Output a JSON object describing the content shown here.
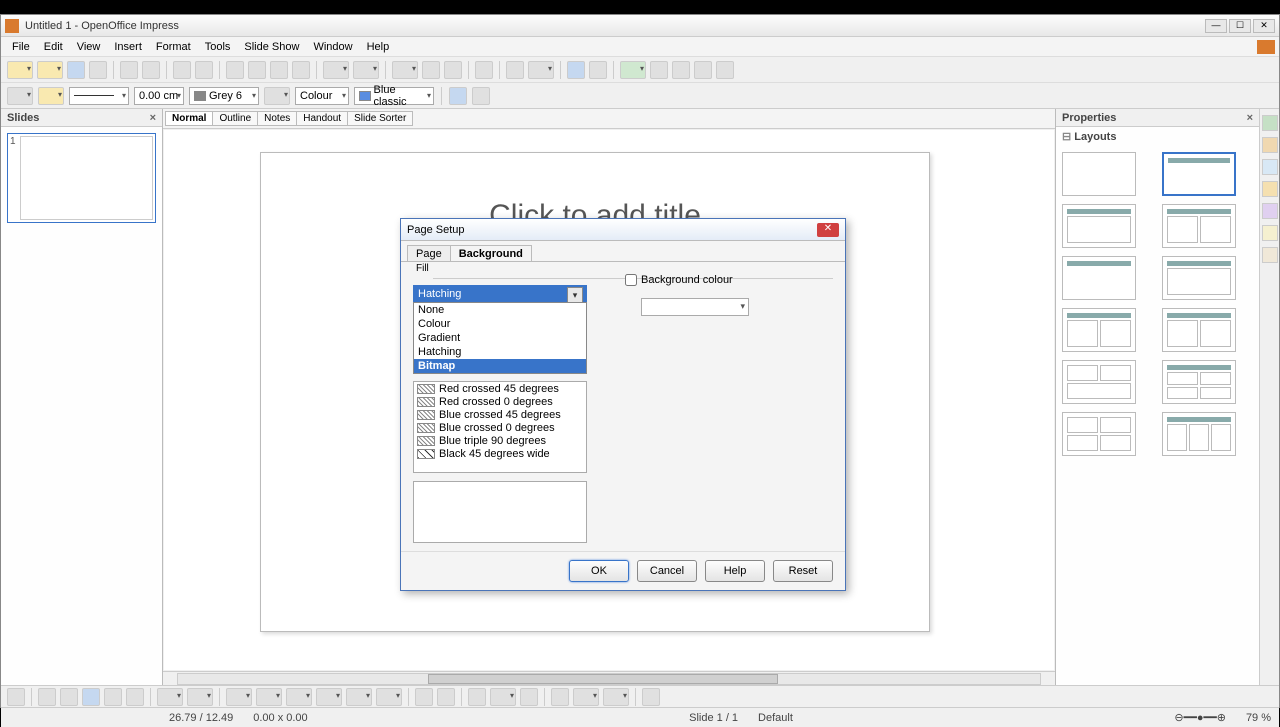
{
  "app": {
    "title": "Untitled 1 - OpenOffice Impress"
  },
  "menu": {
    "items": [
      "File",
      "Edit",
      "View",
      "Insert",
      "Format",
      "Tools",
      "Slide Show",
      "Window",
      "Help"
    ]
  },
  "toolbar2": {
    "width": "0.00 cm",
    "color1": "Grey 6",
    "mode": "Colour",
    "color2": "Blue classic"
  },
  "panel": {
    "slides": "Slides",
    "properties": "Properties",
    "layouts": "Layouts",
    "slidenum": "1"
  },
  "viewtabs": [
    "Normal",
    "Outline",
    "Notes",
    "Handout",
    "Slide Sorter"
  ],
  "slide": {
    "title_placeholder": "Click to add title"
  },
  "dialog": {
    "title": "Page Setup",
    "tabs": {
      "page": "Page",
      "background": "Background"
    },
    "fill_label": "Fill",
    "fill_value": "Hatching",
    "fill_options": [
      "None",
      "Colour",
      "Gradient",
      "Hatching",
      "Bitmap"
    ],
    "highlighted": "Bitmap",
    "hatches": [
      "Red crossed 45 degrees",
      "Red crossed 0 degrees",
      "Blue crossed 45 degrees",
      "Blue crossed 0 degrees",
      "Blue triple 90 degrees",
      "Black 45 degrees wide"
    ],
    "bg_colour": "Background colour",
    "buttons": {
      "ok": "OK",
      "cancel": "Cancel",
      "help": "Help",
      "reset": "Reset"
    }
  },
  "status": {
    "coords": "26.79 / 12.49",
    "size": "0.00 x 0.00",
    "slide": "Slide 1 / 1",
    "style": "Default",
    "zoom": "79 %"
  }
}
